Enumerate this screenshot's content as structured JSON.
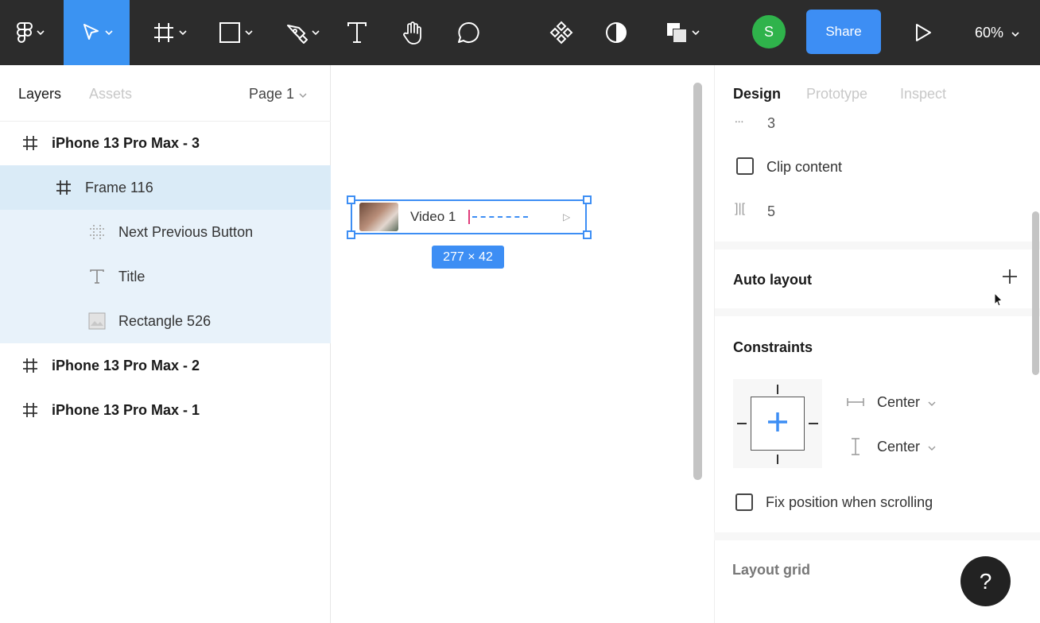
{
  "toolbar": {
    "menu_icon": "figma-logo-icon",
    "move_tool_icon": "move-tool-icon",
    "frame_tool_icon": "frame-tool-icon",
    "shape_tool_icon": "rectangle-tool-icon",
    "pen_tool_icon": "pen-tool-icon",
    "text_tool_icon": "text-tool-icon",
    "hand_tool_icon": "hand-tool-icon",
    "comment_tool_icon": "comment-tool-icon",
    "component_icon": "component-icon",
    "mask_icon": "mask-icon",
    "boolean_icon": "boolean-icon",
    "avatar_initial": "S",
    "share_label": "Share",
    "present_icon": "play-icon",
    "zoom_label": "60%"
  },
  "left_panel": {
    "tab_layers": "Layers",
    "tab_assets": "Assets",
    "page_selector": "Page 1",
    "layers": [
      {
        "label": "iPhone 13 Pro Max - 3",
        "icon": "frame-icon"
      },
      {
        "label": "Frame 116",
        "icon": "frame-icon"
      },
      {
        "label": "Next Previous Button",
        "icon": "component-frame-icon"
      },
      {
        "label": "Title",
        "icon": "text-icon"
      },
      {
        "label": "Rectangle 526",
        "icon": "image-icon"
      },
      {
        "label": "iPhone 13 Pro Max - 2",
        "icon": "frame-icon"
      },
      {
        "label": "iPhone 13 Pro Max - 1",
        "icon": "frame-icon"
      }
    ]
  },
  "canvas": {
    "video_label": "Video 1",
    "dimensions": "277 × 42"
  },
  "right_panel": {
    "tab_design": "Design",
    "tab_prototype": "Prototype",
    "tab_inspect": "Inspect",
    "corner_value": "3",
    "clip_content": "Clip content",
    "spacing_value": "5",
    "auto_layout": "Auto layout",
    "constraints": "Constraints",
    "horizontal_constraint": "Center",
    "vertical_constraint": "Center",
    "fix_position": "Fix position when scrolling",
    "layout_grid": "Layout grid",
    "help": "?"
  },
  "colors": {
    "toolbar_bg": "#2c2c2c",
    "accent": "#3d8ef4",
    "avatar": "#2fb34b",
    "selected_row": "#daebf7"
  }
}
